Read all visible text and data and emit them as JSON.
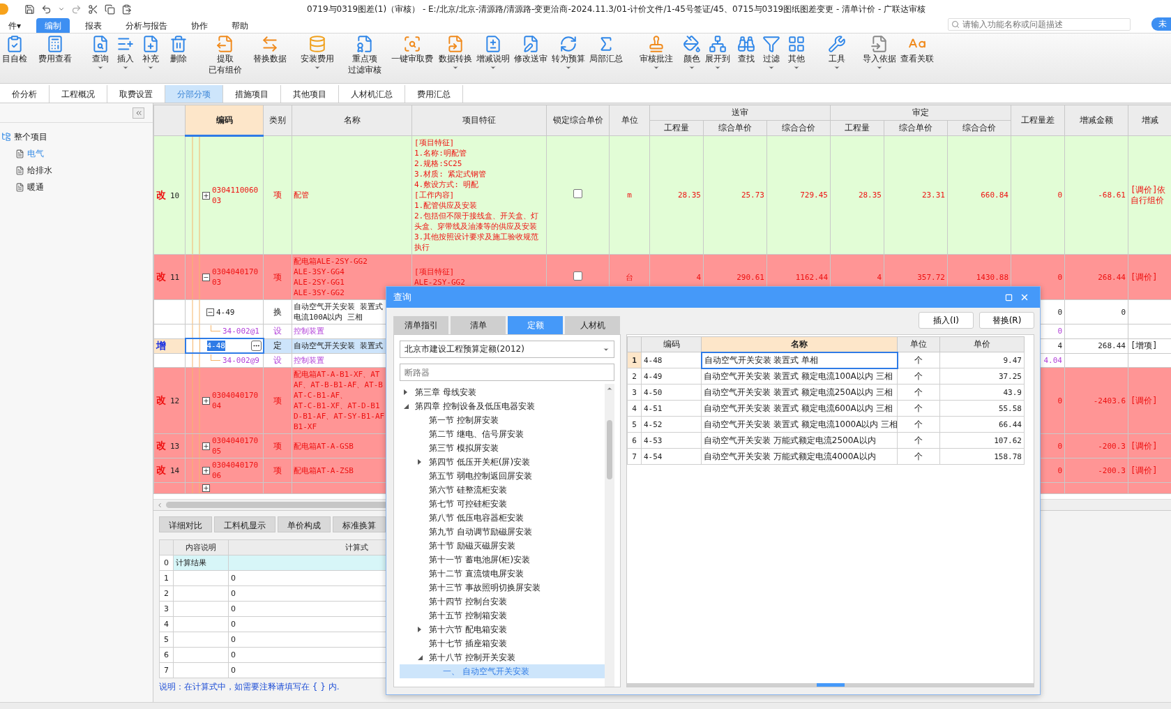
{
  "window": {
    "title": "0719与0319图差(1)（审核） - E:/北京/北京-清源路/清源路-变更洽商-2024.11.3/01-计价文件/1-45号签证/45、0715与0319图纸图差变更 - 清单计价 - 广联达审核"
  },
  "menu": [
    {
      "label": "件▾",
      "selected": false
    },
    {
      "label": "编制",
      "selected": true
    },
    {
      "label": "报表",
      "selected": false
    },
    {
      "label": "分析与报告",
      "selected": false
    },
    {
      "label": "协作",
      "selected": false
    },
    {
      "label": "帮助",
      "selected": false
    }
  ],
  "search": {
    "placeholder": "请输入功能名称或问题描述"
  },
  "account_badge": "未",
  "ribbon": [
    {
      "label": [
        "目自检"
      ],
      "dropdown": false
    },
    {
      "label": [
        "费用查看"
      ],
      "dropdown": false
    },
    {
      "label": [
        "查询"
      ],
      "dropdown": true
    },
    {
      "label": [
        "插入"
      ],
      "dropdown": true
    },
    {
      "label": [
        "补充"
      ],
      "dropdown": true
    },
    {
      "label": [
        "删除"
      ],
      "dropdown": false
    },
    {
      "label": [
        "提取",
        "已有组价"
      ],
      "dropdown": false
    },
    {
      "label": [
        "替换数据"
      ],
      "dropdown": false
    },
    {
      "label": [
        "安装费用"
      ],
      "dropdown": true
    },
    {
      "label": [
        "重点项",
        "过滤审核"
      ],
      "dropdown": false
    },
    {
      "label": [
        "一键审取费"
      ],
      "dropdown": false
    },
    {
      "label": [
        "数据转换"
      ],
      "dropdown": true
    },
    {
      "label": [
        "增减说明"
      ],
      "dropdown": true
    },
    {
      "label": [
        "修改送审"
      ],
      "dropdown": false
    },
    {
      "label": [
        "转为预算"
      ],
      "dropdown": true
    },
    {
      "label": [
        "局部汇总"
      ],
      "dropdown": false
    },
    {
      "label": [
        "审核批注"
      ],
      "dropdown": true
    },
    {
      "label": [
        "颜色"
      ],
      "dropdown": true
    },
    {
      "label": [
        "展开到"
      ],
      "dropdown": true
    },
    {
      "label": [
        "查找"
      ],
      "dropdown": false
    },
    {
      "label": [
        "过滤"
      ],
      "dropdown": true
    },
    {
      "label": [
        "其他"
      ],
      "dropdown": true
    },
    {
      "label": [
        "工具"
      ],
      "dropdown": true
    },
    {
      "label": [
        "导入依据"
      ],
      "dropdown": true
    },
    {
      "label": [
        "查看关联"
      ],
      "dropdown": false
    }
  ],
  "tabs": [
    {
      "label": "价分析",
      "selected": false
    },
    {
      "label": "工程概况",
      "selected": false
    },
    {
      "label": "取费设置",
      "selected": false
    },
    {
      "label": "分部分项",
      "selected": true
    },
    {
      "label": "措施项目",
      "selected": false
    },
    {
      "label": "其他项目",
      "selected": false
    },
    {
      "label": "人材机汇总",
      "selected": false
    },
    {
      "label": "费用汇总",
      "selected": false
    }
  ],
  "sidebar": {
    "root": {
      "label": "整个项目",
      "children": [
        {
          "label": "电气",
          "selected": true
        },
        {
          "label": "给排水",
          "selected": false
        },
        {
          "label": "暖通",
          "selected": false
        }
      ]
    }
  },
  "table": {
    "columns": [
      {
        "label": "编码",
        "selected": true
      },
      {
        "label": "类别",
        "selected": false
      },
      {
        "label": "名称",
        "selected": false
      },
      {
        "label": "项目特征",
        "selected": false
      },
      {
        "label": "锁定综合单价",
        "selected": false
      },
      {
        "label": "单位",
        "selected": false
      }
    ],
    "groups": [
      {
        "label": "送审",
        "columns": [
          "工程量",
          "综合单价",
          "综合合价"
        ]
      },
      {
        "label": "审定",
        "columns": [
          "工程量",
          "综合单价",
          "综合合价"
        ]
      }
    ],
    "tail_columns": [
      "工程量差",
      "增减金额",
      "增减"
    ],
    "rows": [
      {
        "kind": "item",
        "selected": false,
        "color": "#e2fdd6",
        "mark": {
          "text": "改",
          "color": "#ee1111"
        },
        "no": "10",
        "expanded": false,
        "code": "030411006003",
        "type": "项",
        "name": [
          "配管"
        ],
        "features": [
          "[项目特征]",
          "1.名称:明配管",
          "2.规格:SC25",
          "3.材质: 紧定式钢管",
          "4.敷设方式: 明配",
          "[工作内容]",
          "1.配管供应及安装",
          "2.包括但不限于接线盒、开关盒、灯头盒、穿带线及油漆等的供应及安装",
          "3.其他按照设计要求及施工验收规范执行"
        ],
        "locked": false,
        "unit": "m",
        "values": {
          "sub_qty": "28.35",
          "sub_price": "25.73",
          "sub_total": "729.45",
          "ap_qty": "28.35",
          "ap_price": "23.31",
          "ap_total": "660.84",
          "qty_diff": "0",
          "diff_amount": "-68.61"
        },
        "note": [
          "[调价]依",
          "自行组价"
        ]
      },
      {
        "kind": "item",
        "selected": false,
        "color": "#ff9595",
        "mark": {
          "text": "改",
          "color": "#ee1111"
        },
        "no": "11",
        "expanded": true,
        "code": "030404017003",
        "type": "项",
        "name": [
          "配电箱ALE-2SY-GG2",
          "ALE-3SY-GG4",
          "ALE-2SY-GG1",
          "ALE-3SY-GG2"
        ],
        "features": [
          "[项目特征]",
          "ALE-2SY-GG2"
        ],
        "locked": false,
        "unit": "台",
        "values": {
          "sub_qty": "4",
          "sub_price": "290.61",
          "sub_total": "1162.44",
          "ap_qty": "4",
          "ap_price": "357.72",
          "ap_total": "1430.88",
          "qty_diff": "0",
          "diff_amount": "268.44"
        },
        "note": [
          "[调价]"
        ]
      },
      {
        "kind": "quota",
        "selected": false,
        "expanded": true,
        "code": "4-49",
        "type": "换",
        "name": [
          "自动空气开关安装 装置式",
          "电流100A以内 三相"
        ],
        "values": {
          "qty_diff": "0",
          "diff_amount": "0"
        }
      },
      {
        "kind": "device",
        "selected": false,
        "code": "34-002@1",
        "type": "设",
        "name": [
          "控制装置"
        ],
        "values": {
          "qty_diff": "0"
        }
      },
      {
        "kind": "quota",
        "selected": true,
        "mark": {
          "text": "增",
          "color": "#1a2fe0"
        },
        "code": "4-48",
        "type": "定",
        "name": [
          "自动空气开关安装 装置式"
        ],
        "values": {
          "qty_diff": "4",
          "diff_amount": "268.44"
        },
        "note": [
          "[增项]"
        ]
      },
      {
        "kind": "device",
        "selected": false,
        "code": "34-002@9",
        "type": "设",
        "name": [
          "控制装置"
        ],
        "values": {
          "qty_diff": "4.04"
        }
      },
      {
        "kind": "item",
        "selected": false,
        "color": "#ff9595",
        "mark": {
          "text": "改",
          "color": "#ee1111"
        },
        "no": "12",
        "expanded": false,
        "code": "030404017004",
        "type": "项",
        "name": [
          "配电箱AT-A-B1-XF、AT",
          "AF、AT-B-B1-AF、AT-B",
          "AT-C-B1-AF、",
          "AT-C-B1-XF、AT-D-B1",
          "D-B1-AF、AT-SY-B1-AF",
          "B1-XF"
        ],
        "values": {
          "qty_diff": "0",
          "diff_amount": "-2403.6"
        },
        "note": [
          "[调价]"
        ]
      },
      {
        "kind": "item",
        "selected": false,
        "color": "#ff9595",
        "mark": {
          "text": "改",
          "color": "#ee1111"
        },
        "no": "13",
        "expanded": false,
        "code": "030404017005",
        "type": "项",
        "name": [
          "配电箱AT-A-GSB"
        ],
        "values": {
          "qty_diff": "0",
          "diff_amount": "-200.3"
        },
        "note": [
          "[调价]"
        ]
      },
      {
        "kind": "item",
        "selected": false,
        "color": "#ff9595",
        "mark": {
          "text": "改",
          "color": "#ee1111"
        },
        "no": "14",
        "expanded": false,
        "code": "030404017006",
        "type": "项",
        "name": [
          "配电箱AT-A-ZSB"
        ],
        "values": {
          "qty_diff": "0",
          "diff_amount": "-200.3"
        },
        "note": [
          "[调价]"
        ]
      },
      {
        "kind": "item",
        "selected": false,
        "color": "#ff9595",
        "expanded": false
      }
    ]
  },
  "detail_tabs": [
    {
      "label": "详细对比",
      "selected": false
    },
    {
      "label": "工料机显示",
      "selected": false
    },
    {
      "label": "单价构成",
      "selected": false
    },
    {
      "label": "标准换算",
      "selected": false
    }
  ],
  "formula_table": {
    "columns": [
      "内容说明",
      "计算式"
    ],
    "rows": [
      {
        "no": "0",
        "desc": "计算结果",
        "highlight": true
      },
      {
        "no": "1",
        "formula": "0",
        "highlight": false
      },
      {
        "no": "2",
        "formula": "0",
        "highlight": false
      },
      {
        "no": "3",
        "formula": "0",
        "highlight": false
      },
      {
        "no": "4",
        "formula": "0",
        "highlight": false
      },
      {
        "no": "5",
        "formula": "0",
        "highlight": false
      },
      {
        "no": "6",
        "formula": "0",
        "highlight": false
      },
      {
        "no": "7",
        "formula": "0",
        "highlight": false
      }
    ],
    "note": "说明：在计算式中，如需要注释请填写在 { } 内."
  },
  "dialog": {
    "title": "查询",
    "tabs": [
      {
        "label": "清单指引",
        "selected": false
      },
      {
        "label": "清单",
        "selected": false
      },
      {
        "label": "定额",
        "selected": true
      },
      {
        "label": "人材机",
        "selected": false
      }
    ],
    "buttons": [
      "插入(I)",
      "替换(R)"
    ],
    "library": "北京市建设工程预算定额(2012)",
    "filter": {
      "placeholder": "断路器"
    },
    "tree": [
      {
        "label": "第三章 母线安装",
        "expanded": false,
        "selected": false
      },
      {
        "label": "第四章 控制设备及低压电器安装",
        "expanded": true,
        "selected": false,
        "children": [
          {
            "label": "第一节 控制屏安装",
            "selected": false
          },
          {
            "label": "第二节 继电、信号屏安装",
            "selected": false
          },
          {
            "label": "第三节 模拟屏安装",
            "selected": false
          },
          {
            "label": "第四节 低压开关柜(屏)安装",
            "expanded": false,
            "selected": false
          },
          {
            "label": "第五节 弱电控制返回屏安装",
            "selected": false
          },
          {
            "label": "第六节 硅整流柜安装",
            "selected": false
          },
          {
            "label": "第七节 可控硅柜安装",
            "selected": false
          },
          {
            "label": "第八节 低压电容器柜安装",
            "selected": false
          },
          {
            "label": "第九节 自动调节励磁屏安装",
            "selected": false
          },
          {
            "label": "第十节 励磁灭磁屏安装",
            "selected": false
          },
          {
            "label": "第十一节 蓄电池屏(柜)安装",
            "selected": false
          },
          {
            "label": "第十二节 直流馈电屏安装",
            "selected": false
          },
          {
            "label": "第十三节 事故照明切换屏安装",
            "selected": false
          },
          {
            "label": "第十四节 控制台安装",
            "selected": false
          },
          {
            "label": "第十五节 控制箱安装",
            "selected": false
          },
          {
            "label": "第十六节 配电箱安装",
            "expanded": false,
            "selected": false
          },
          {
            "label": "第十七节 插座箱安装",
            "selected": false
          },
          {
            "label": "第十八节 控制开关安装",
            "expanded": true,
            "selected": false,
            "children": [
              {
                "label": "一、 自动空气开关安装",
                "selected": true
              }
            ]
          }
        ]
      }
    ],
    "grid": {
      "columns": [
        {
          "label": "编码",
          "selected": false
        },
        {
          "label": "名称",
          "selected": true
        },
        {
          "label": "单位",
          "selected": false
        },
        {
          "label": "单价",
          "selected": false
        }
      ],
      "rows": [
        {
          "no": "1",
          "code": "4-48",
          "name": "自动空气开关安装 装置式 单相",
          "unit": "个",
          "price": "9.47",
          "selected": true
        },
        {
          "no": "2",
          "code": "4-49",
          "name": "自动空气开关安装 装置式 额定电流100A以内 三相",
          "unit": "个",
          "price": "37.25",
          "selected": false
        },
        {
          "no": "3",
          "code": "4-50",
          "name": "自动空气开关安装 装置式 额定电流250A以内 三相",
          "unit": "个",
          "price": "43.9",
          "selected": false
        },
        {
          "no": "4",
          "code": "4-51",
          "name": "自动空气开关安装 装置式 额定电流600A以内 三相",
          "unit": "个",
          "price": "55.58",
          "selected": false
        },
        {
          "no": "5",
          "code": "4-52",
          "name": "自动空气开关安装 装置式 额定电流1000A以内 三相",
          "unit": "个",
          "price": "66.44",
          "selected": false
        },
        {
          "no": "6",
          "code": "4-53",
          "name": "自动空气开关安装 万能式额定电流2500A以内",
          "unit": "个",
          "price": "107.62",
          "selected": false
        },
        {
          "no": "7",
          "code": "4-54",
          "name": "自动空气开关安装 万能式额定电流4000A以内",
          "unit": "个",
          "price": "158.78",
          "selected": false
        }
      ]
    }
  }
}
